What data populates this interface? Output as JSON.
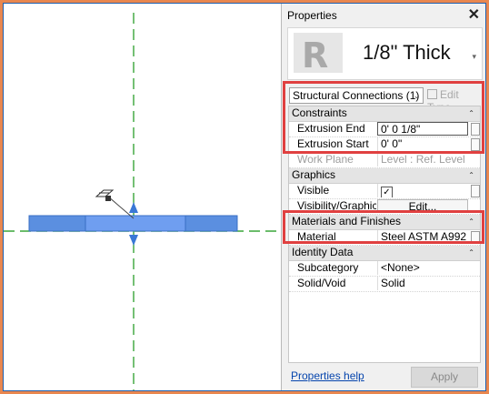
{
  "properties": {
    "title": "Properties",
    "close": "✕",
    "type_name": "1/8\" Thick",
    "selector": "Structural Connections (1)",
    "edit_type": "Edit Type",
    "sections": {
      "constraints": "Constraints",
      "graphics": "Graphics",
      "materials": "Materials and Finishes",
      "identity": "Identity Data"
    },
    "rows": {
      "extrusion_end": {
        "label": "Extrusion End",
        "value": "0'  0 1/8\""
      },
      "extrusion_start": {
        "label": "Extrusion Start",
        "value": "0'  0\""
      },
      "work_plane": {
        "label": "Work Plane",
        "value": "Level : Ref. Level"
      },
      "visible": {
        "label": "Visible",
        "value": "✓"
      },
      "vis_graphics": {
        "label": "Visibility/Graphics ...",
        "value": "Edit..."
      },
      "material": {
        "label": "Material",
        "value": "Steel ASTM A992"
      },
      "subcategory": {
        "label": "Subcategory",
        "value": "<None>"
      },
      "solid_void": {
        "label": "Solid/Void",
        "value": "Solid"
      }
    },
    "help_link": "Properties help",
    "apply": "Apply"
  },
  "colors": {
    "outer_border": "#e9874f",
    "highlight": "#e04040",
    "plate": "#5b8fe0",
    "axis_line": "#3aa63a"
  }
}
